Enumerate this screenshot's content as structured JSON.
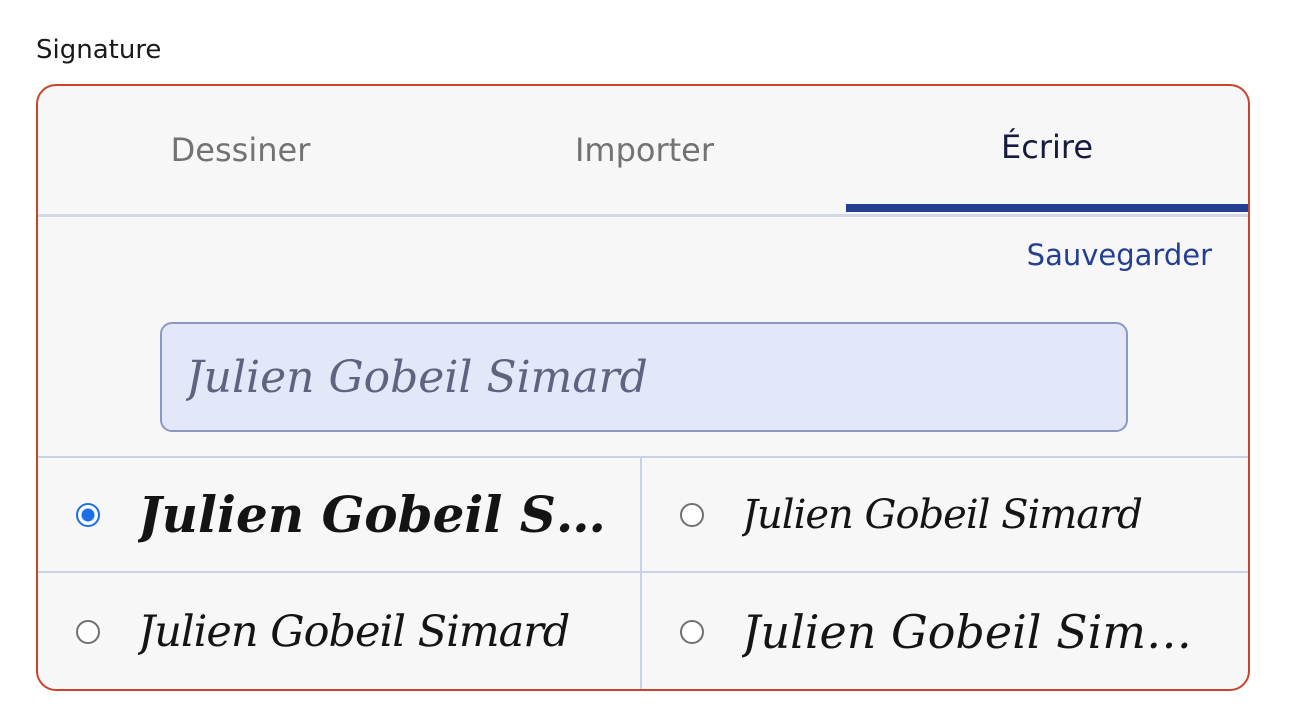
{
  "field": {
    "label": "Signature"
  },
  "tabs": [
    {
      "label": "Dessiner",
      "active": false
    },
    {
      "label": "Importer",
      "active": false
    },
    {
      "label": "Écrire",
      "active": true
    }
  ],
  "actions": {
    "save_label": "Sauvegarder"
  },
  "input": {
    "value": "Julien Gobeil Simard"
  },
  "options": [
    {
      "text": "Julien Gobeil Simard",
      "selected": true
    },
    {
      "text": "Julien Gobeil Simard",
      "selected": false
    },
    {
      "text": "Julien Gobeil Simard",
      "selected": false
    },
    {
      "text": "Julien Gobeil Simard",
      "selected": false
    }
  ],
  "colors": {
    "border_error": "#c9442a",
    "accent": "#233f91",
    "radio_selected": "#1a6fe8",
    "input_bg": "#e3e8f8"
  }
}
